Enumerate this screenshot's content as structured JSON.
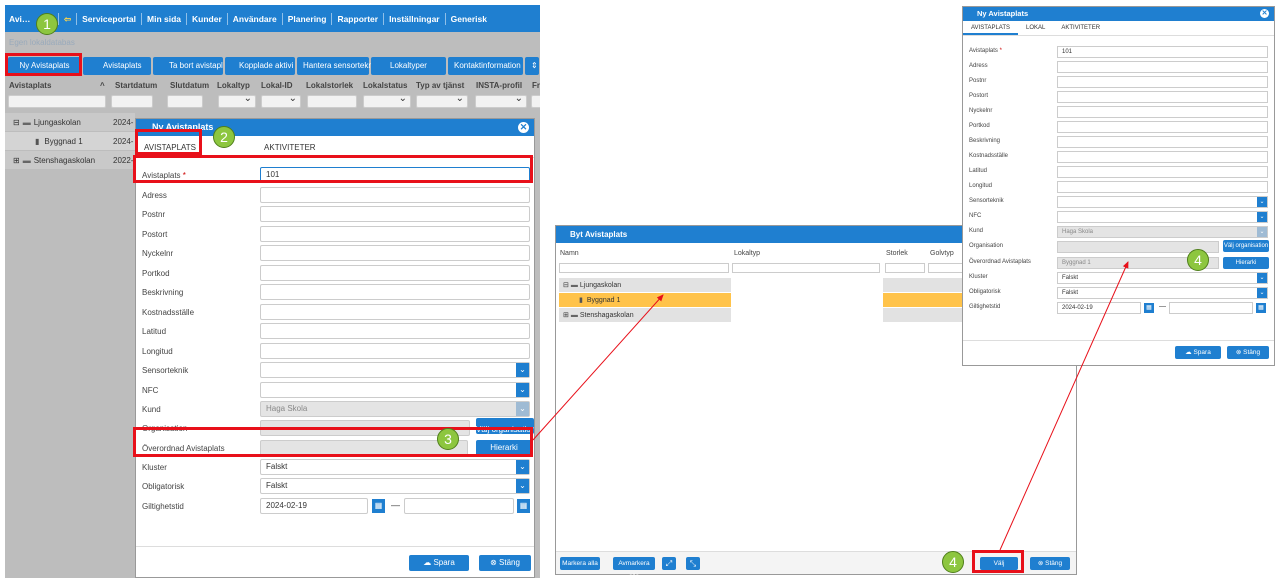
{
  "main": {
    "topbar": {
      "items": [
        "Avi…",
        "Serviceportal",
        "Min sida",
        "Kunder",
        "Användare",
        "Planering",
        "Rapporter",
        "Inställningar",
        "Generisk"
      ]
    },
    "breadcrumb": "Egen lokaldatabas",
    "toolbar": {
      "new_label": "Ny Avistaplats",
      "avistaplats_label": "Avistaplats",
      "delete_label": "Ta bort avistapl",
      "linked_label": "Kopplade aktivi",
      "sensors_label": "Hantera sensortekn",
      "room_types_label": "Lokaltyper",
      "contact_label": "Kontaktinformation"
    },
    "columns": [
      "Avistaplats",
      "Startdatum",
      "Slutdatum",
      "Lokaltyp",
      "Lokal-ID",
      "Lokalstorlek",
      "Lokalstatus",
      "Typ av tjänst",
      "INSTA-profil",
      "Fre"
    ],
    "tree": [
      {
        "name": "Ljungaskolan",
        "date": "2024-"
      },
      {
        "name": "Byggnad 1",
        "date": "2024-"
      },
      {
        "name": "Stenshagaskolan",
        "date": "2022-"
      }
    ]
  },
  "dialog": {
    "title": "Ny Avistaplats",
    "tabs": [
      "AVISTAPLATS",
      "AKTIVITETER"
    ],
    "fields": {
      "avistaplats": {
        "label": "Avistaplats",
        "required": "*",
        "value": "101"
      },
      "adress": "Adress",
      "postnr": "Postnr",
      "postort": "Postort",
      "nyckelnr": "Nyckelnr",
      "portkod": "Portkod",
      "beskrivning": "Beskrivning",
      "kostnadsstalle": "Kostnadsställe",
      "latitud": "Latitud",
      "longitud": "Longitud",
      "sensorteknik": "Sensorteknik",
      "nfc": "NFC",
      "kund": {
        "label": "Kund",
        "value": "Haga Skola"
      },
      "organisation": "Organisation",
      "overordnad": "Överordnad Avistaplats",
      "kluster": {
        "label": "Kluster",
        "value": "Falskt"
      },
      "obligatorisk": {
        "label": "Obligatorisk",
        "value": "Falskt"
      },
      "giltighetstid": {
        "label": "Giltighetstid",
        "from": "2024-02-19",
        "dash": "—"
      }
    },
    "valj_org_label": "Välj organisation",
    "hierarki_label": "Hierarki",
    "save_label": "Spara",
    "close_label": "Stäng"
  },
  "byt": {
    "title": "Byt Avistaplats",
    "columns": [
      "Namn",
      "Lokaltyp",
      "Storlek",
      "Golvtyp"
    ],
    "rows": [
      "Ljungaskolan",
      "Byggnad 1",
      "Stenshagaskolan"
    ],
    "mark_all": "Markera alla",
    "unmark_all": "Avmarkera alla",
    "choose": "Välj",
    "close": "Stäng"
  },
  "mini": {
    "title": "Ny Avistaplats",
    "tabs": [
      "AVISTAPLATS",
      "LOKAL",
      "AKTIVITETER"
    ],
    "avistaplats_value": "101",
    "kund_value": "Haga Skola",
    "overordnad_value": "Byggnad 1",
    "kluster_value": "Falskt",
    "obligatorisk_value": "Falskt",
    "date_from": "2024-02-19",
    "valj_org": "Välj organisation",
    "hierarki": "Hierarki",
    "save": "Spara",
    "close": "Stäng"
  },
  "badges": [
    "1",
    "2",
    "3",
    "4",
    "4"
  ],
  "colors": {
    "accent": "#1f7fd0",
    "highlight": "#e8101a",
    "badge": "#8dc63f",
    "selected_row": "#ffc34a"
  }
}
